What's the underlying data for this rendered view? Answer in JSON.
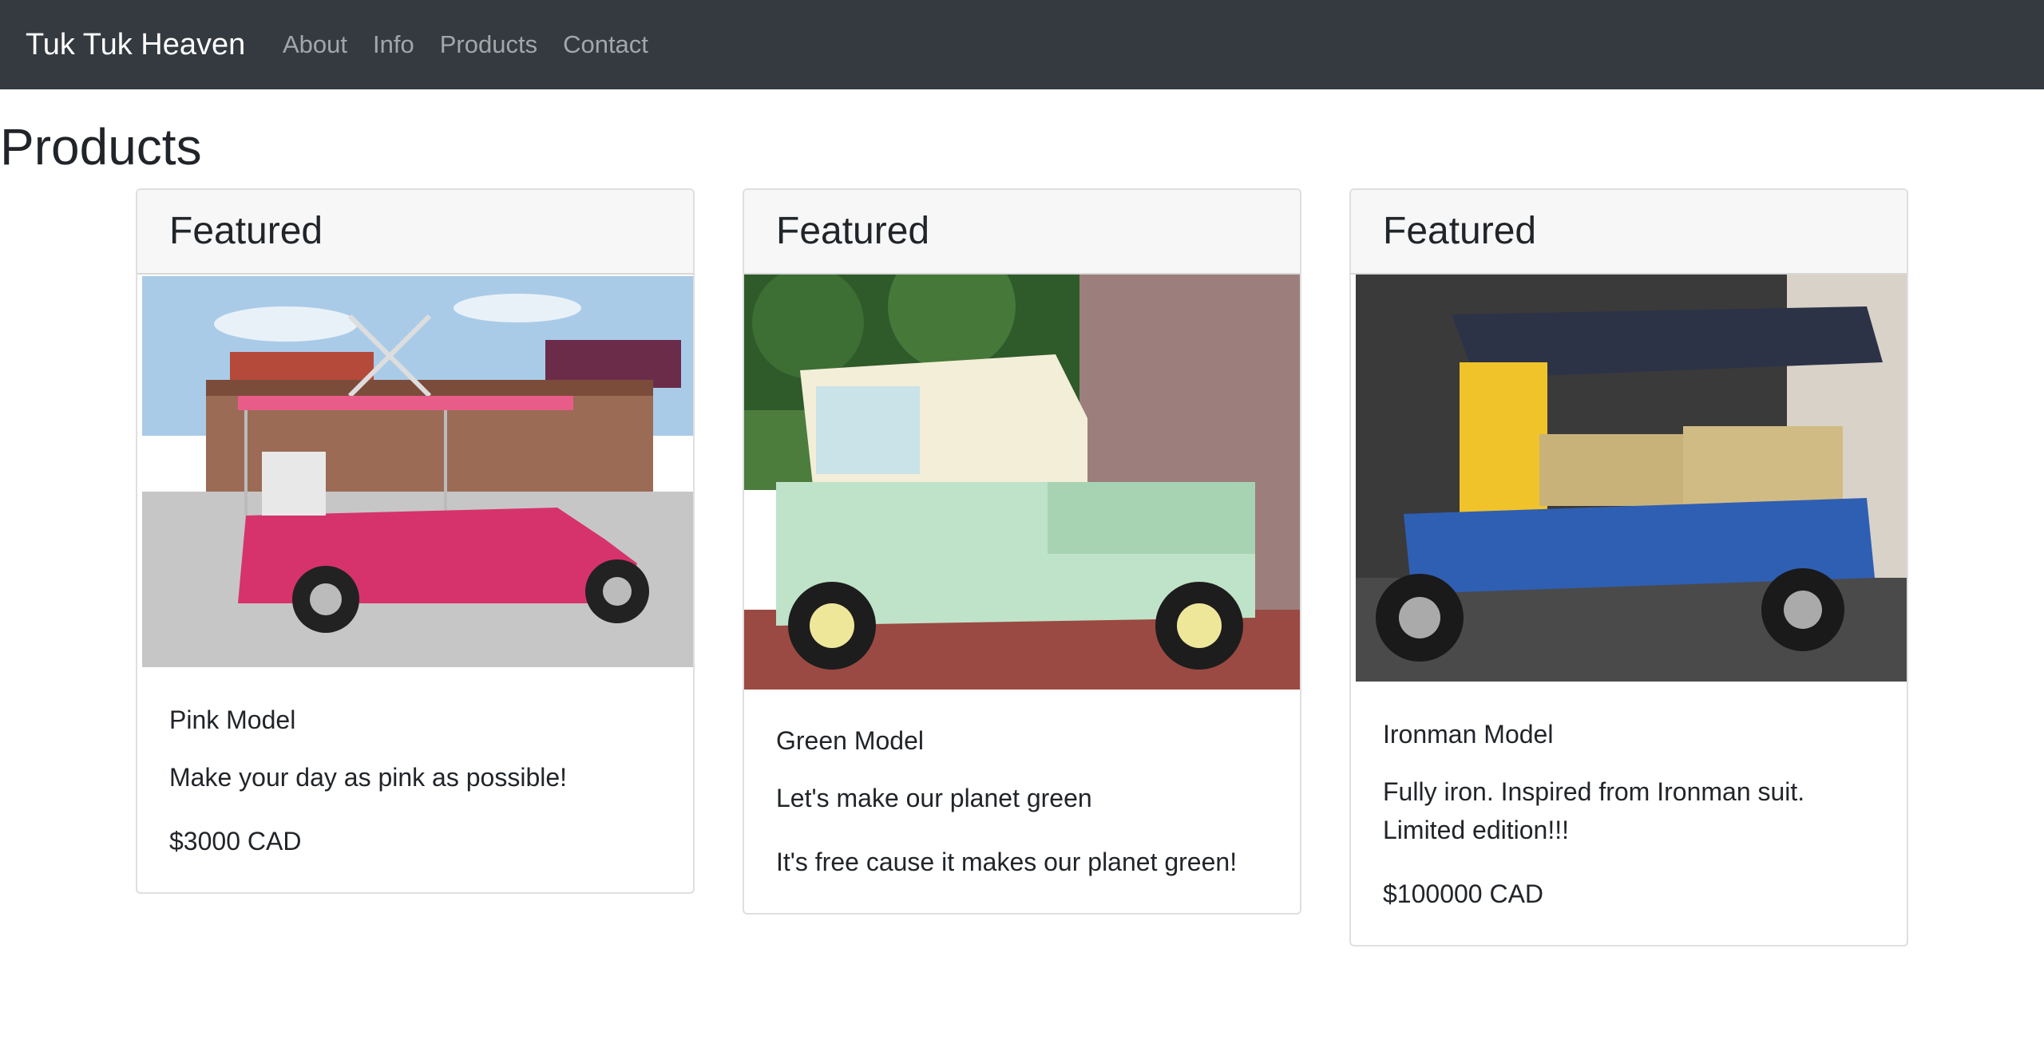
{
  "nav": {
    "brand": "Tuk Tuk Heaven",
    "links": [
      "About",
      "Info",
      "Products",
      "Contact"
    ]
  },
  "page": {
    "title": "Products"
  },
  "products": [
    {
      "header": "Featured",
      "name": "Pink Model",
      "description": "Make your day as pink as possible!",
      "price": "$3000 CAD",
      "image_icon": "pink-tuktuk-photo"
    },
    {
      "header": "Featured",
      "name": "Green Model",
      "description": "Let's make our planet green",
      "price": "It's free cause it makes our planet green!",
      "image_icon": "green-tuktuk-photo"
    },
    {
      "header": "Featured",
      "name": "Ironman Model",
      "description_line1": "Fully iron. Inspired from Ironman suit.",
      "description_line2": "Limited edition!!!",
      "price": "$100000 CAD",
      "image_icon": "ironman-tuktuk-photo"
    }
  ],
  "colors": {
    "navbar": "#343a40",
    "pink_vehicle": "#d6336c",
    "green_vehicle": "#bfe3c8",
    "blue_vehicle": "#2f5fb3"
  }
}
